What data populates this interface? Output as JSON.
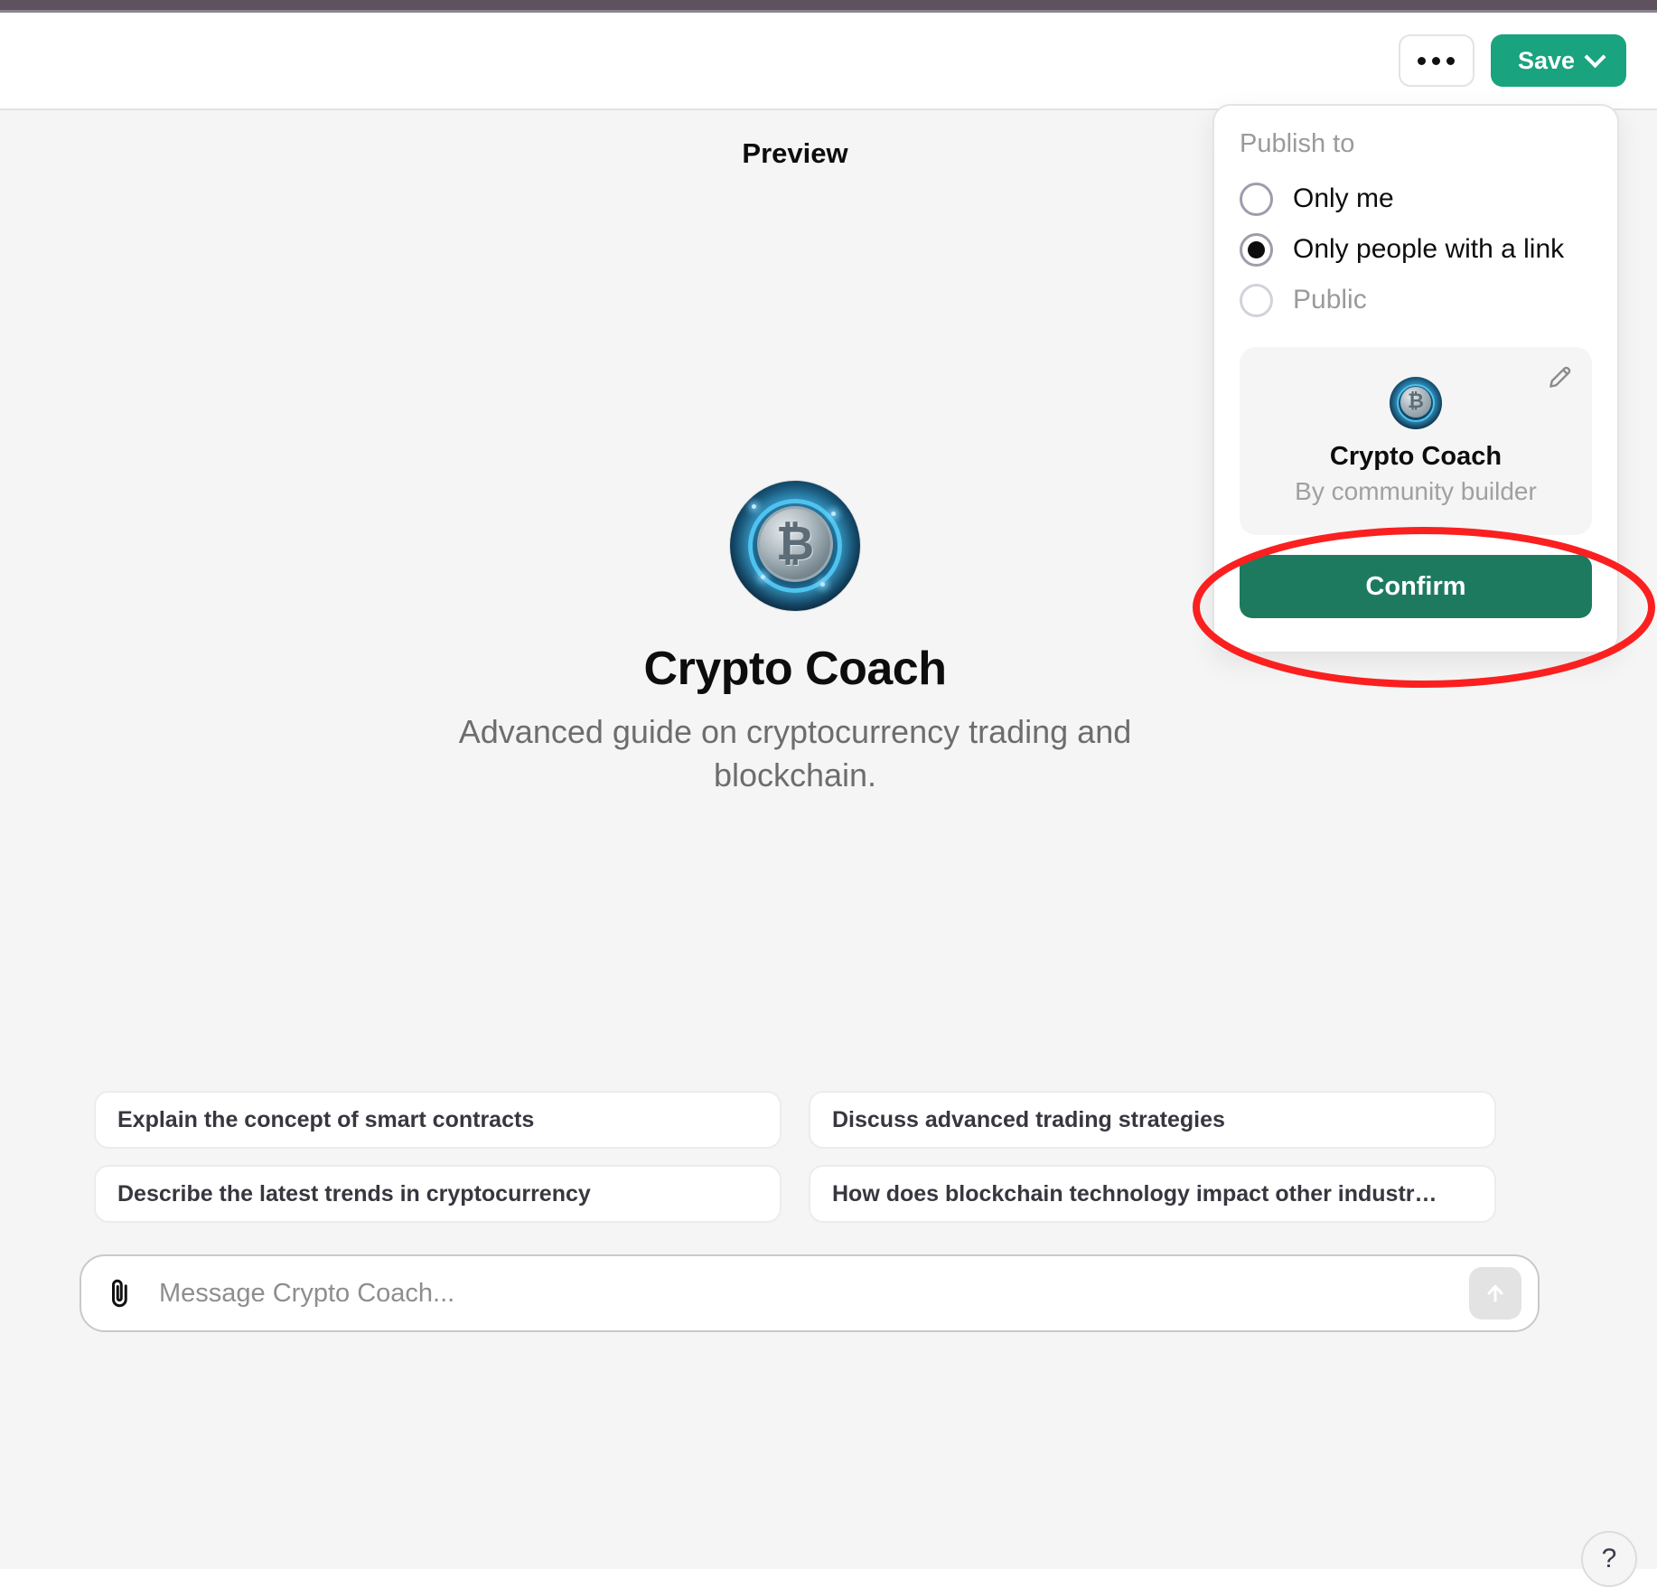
{
  "header": {
    "more_button_label": "···",
    "more_button_name": "more-options",
    "save_label": "Save",
    "save_color": "#19a37e"
  },
  "preview": {
    "label": "Preview",
    "gpt_name": "Crypto Coach",
    "gpt_description": "Advanced guide on cryptocurrency trading and blockchain.",
    "avatar_glyph": "₿",
    "starter_prompts": [
      "Explain the concept of smart contracts",
      "Discuss advanced trading strategies",
      "Describe the latest trends in cryptocurrency",
      "How does blockchain technology impact other industr…"
    ],
    "composer": {
      "placeholder": "Message Crypto Coach...",
      "value": "",
      "attach_icon": "paperclip-icon",
      "send_icon": "arrow-up-icon"
    },
    "help_button_label": "?"
  },
  "publish_panel": {
    "section_label": "Publish to",
    "options": [
      {
        "label": "Only me",
        "selected": false,
        "disabled": false
      },
      {
        "label": "Only people with a link",
        "selected": true,
        "disabled": false
      },
      {
        "label": "Public",
        "selected": false,
        "disabled": true
      }
    ],
    "card": {
      "title": "Crypto Coach",
      "byline": "By community builder",
      "avatar_glyph": "₿",
      "edit_icon": "pencil-icon"
    },
    "confirm_label": "Confirm",
    "confirm_color": "#1e7a5f"
  },
  "annotation": {
    "shape": "ellipse",
    "color": "#fa2020",
    "targets": "Confirm"
  }
}
